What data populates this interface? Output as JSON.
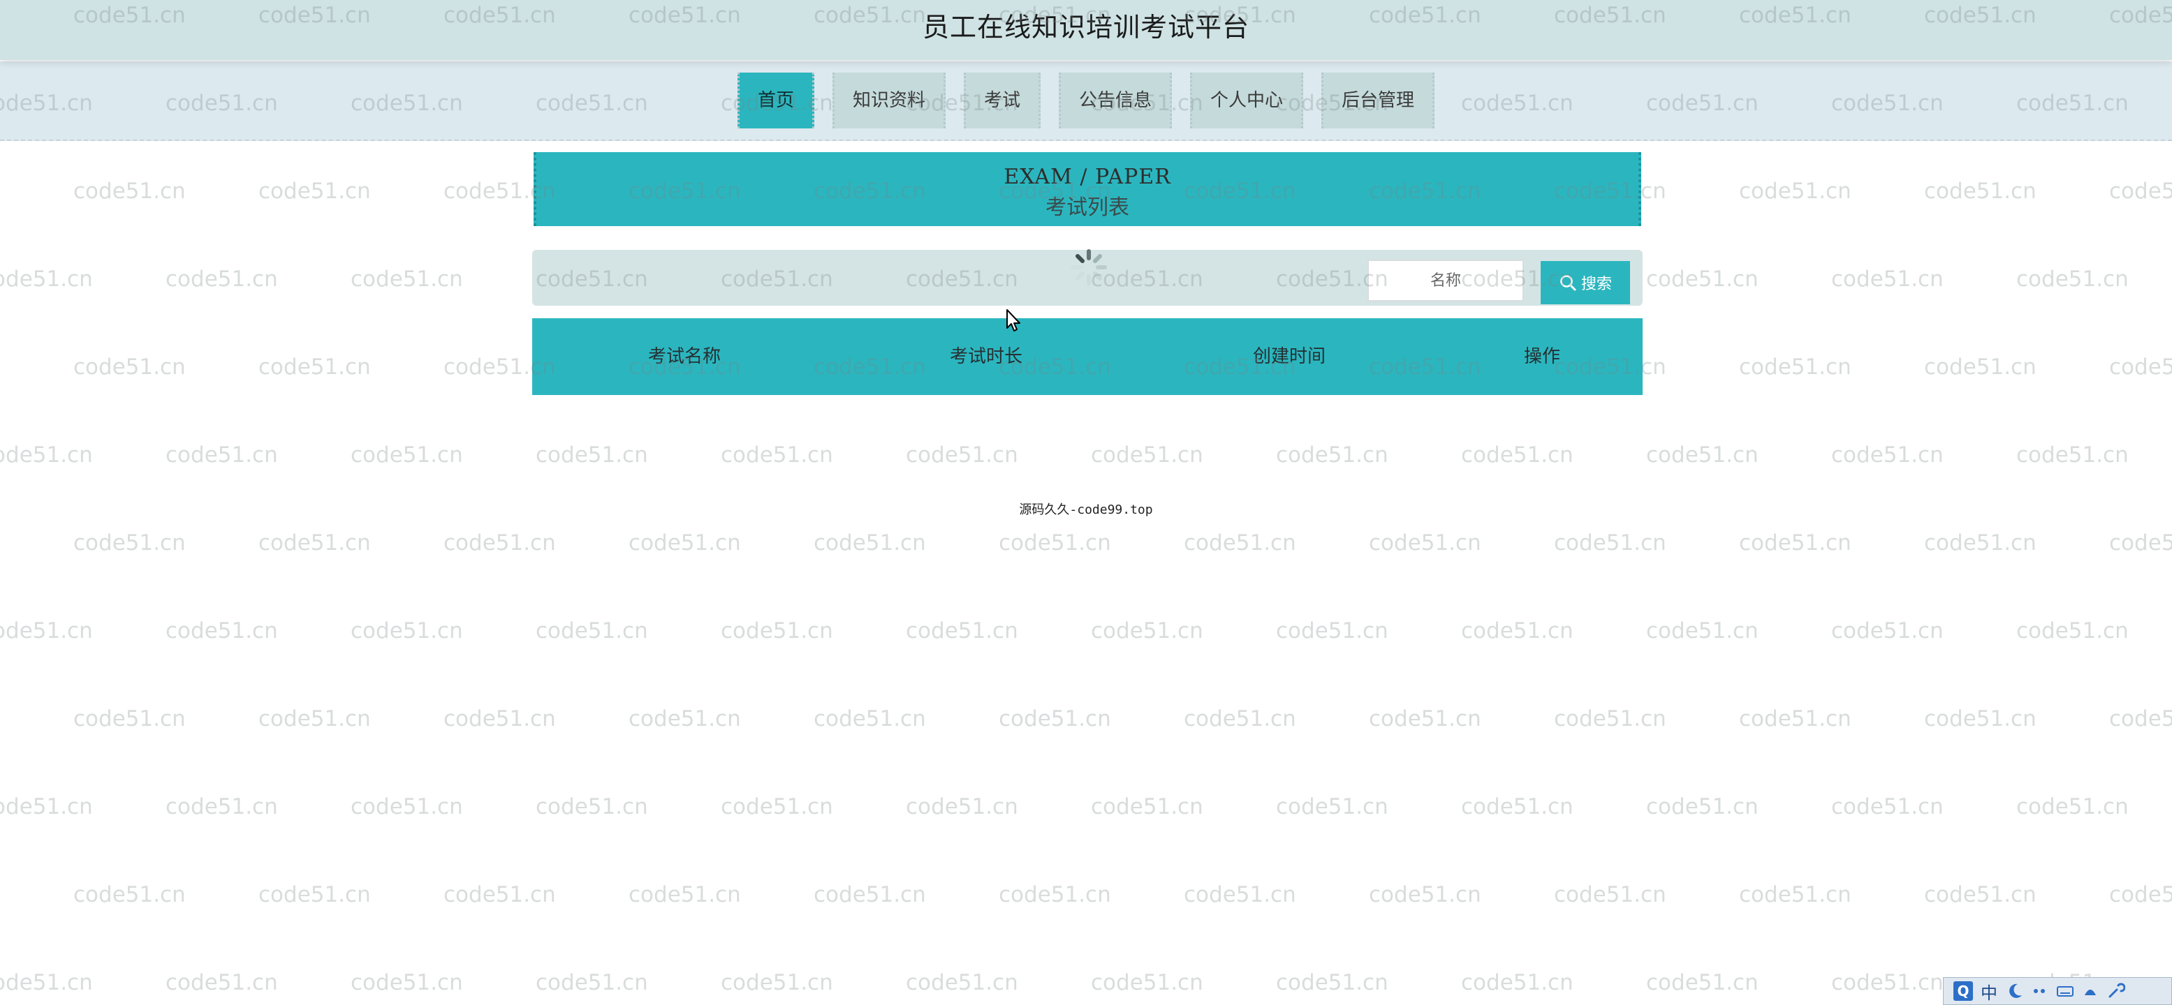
{
  "header": {
    "title": "员工在线知识培训考试平台"
  },
  "nav": {
    "items": [
      {
        "label": "首页",
        "active": true
      },
      {
        "label": "知识资料",
        "active": false
      },
      {
        "label": "考试",
        "active": false
      },
      {
        "label": "公告信息",
        "active": false
      },
      {
        "label": "个人中心",
        "active": false
      },
      {
        "label": "后台管理",
        "active": false
      }
    ]
  },
  "banner": {
    "title_en": "EXAM / PAPER",
    "title_zh": "考试列表"
  },
  "search": {
    "placeholder": "名称",
    "button_label": "搜索"
  },
  "table": {
    "columns": [
      "考试名称",
      "考试时长",
      "创建时间",
      "操作"
    ]
  },
  "footer": {
    "text": "源码久久-code99.top"
  },
  "watermark": {
    "text": "code51.cn"
  },
  "ime": {
    "lang": "中"
  },
  "colors": {
    "accent": "#2bb6bf",
    "title_bar": "#cfe2e4",
    "nav_bar": "#dce9ef",
    "nav_item": "#c5dadb"
  }
}
